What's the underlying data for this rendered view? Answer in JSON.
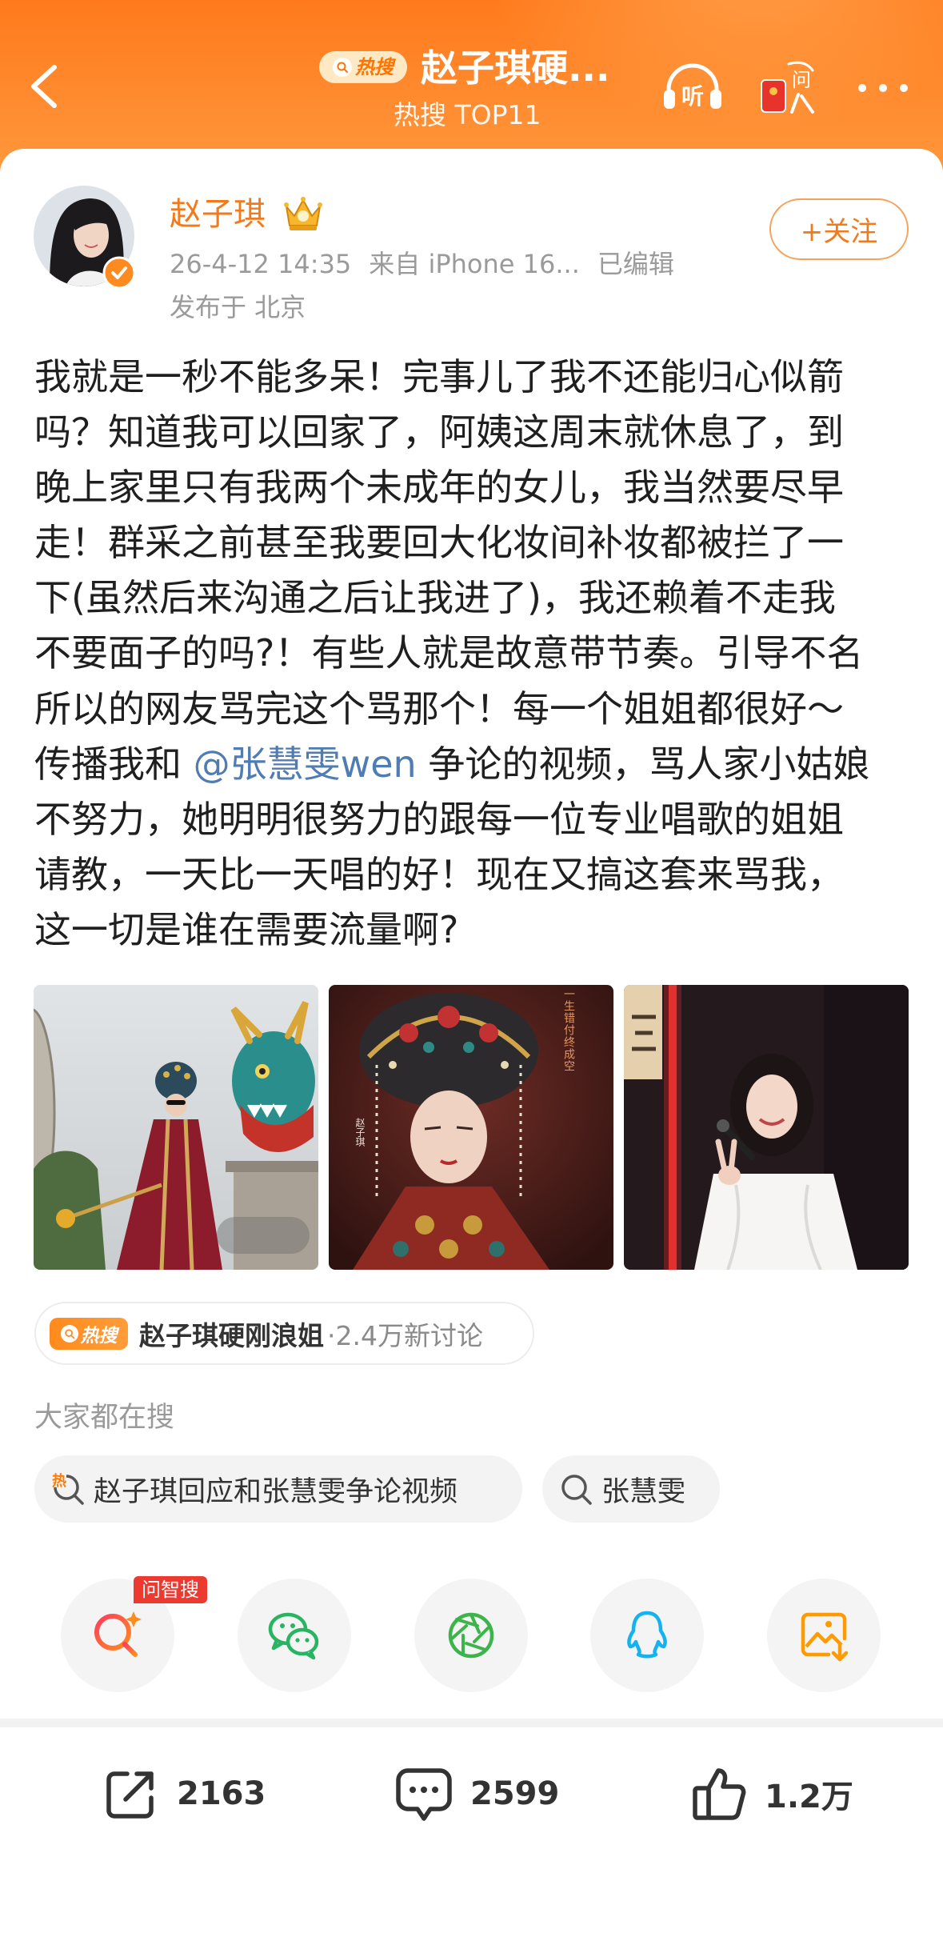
{
  "header": {
    "hot_badge": "热搜",
    "title": "赵子琪硬...",
    "subtitle": "热搜 TOP11",
    "listen_label": "听",
    "ask_label": "问",
    "icons": [
      "chevron-left-icon",
      "headphones-icon",
      "red-packet-icon",
      "more-icon"
    ]
  },
  "post": {
    "author": "赵子琪",
    "meta": {
      "time": "26-4-12 14:35",
      "source": "来自 iPhone 16...",
      "edited": "已编辑"
    },
    "location": "发布于 北京",
    "follow_label": "+关注",
    "lines": [
      [
        {
          "text": "我就是一秒不能多呆！完事儿了我不还能归心似箭"
        }
      ],
      [
        {
          "text": "吗？知道我可以回家了，阿姨这周末就休息了，到"
        }
      ],
      [
        {
          "text": "晚上家里只有我两个未成年的女儿，我当然要尽早"
        }
      ],
      [
        {
          "text": "走！群采之前甚至我要回大化妆间补妆都被拦了一"
        }
      ],
      [
        {
          "text": "下(虽然后来沟通之后让我进了)，我还赖着不走我"
        }
      ],
      [
        {
          "text": "不要面子的吗?！有些人就是故意带节奏。引导不名"
        }
      ],
      [
        {
          "text": "所以的网友骂完这个骂那个！每一个姐姐都很好～"
        }
      ],
      [
        {
          "text": "传播我和 "
        },
        {
          "text": "@张慧雯wen",
          "mention": true
        },
        {
          "text": " 争论的视频，骂人家小姑娘"
        }
      ],
      [
        {
          "text": "不努力，她明明很努力的跟每一位专业唱歌的姐姐"
        }
      ],
      [
        {
          "text": "请教，一天比一天唱的好！现在又搞这套来骂我，"
        }
      ],
      [
        {
          "text": "这一切是谁在需要流量啊?"
        }
      ]
    ],
    "gallery": {
      "tile_2_caption": "一生错付终成空",
      "tile_2_name": "赵子琪"
    }
  },
  "hot_topic": {
    "badge": "热搜",
    "title": "赵子琪硬刚浪姐",
    "stat": "·2.4万新讨论"
  },
  "search": {
    "heading": "大家都在搜",
    "chips": [
      {
        "label": "赵子琪回应和张慧雯争论视频",
        "icon": "hot-search-icon",
        "icon_char": "热"
      },
      {
        "label": "张慧雯",
        "icon": "search-icon"
      }
    ]
  },
  "share": {
    "ai_tag": "问智搜",
    "targets": [
      "ai-search-icon",
      "wechat-icon",
      "moments-icon",
      "qq-icon",
      "save-image-icon"
    ]
  },
  "actions": {
    "repost": "2163",
    "comments": "2599",
    "likes": "1.2万"
  },
  "colors": {
    "header_orange": "#ff7a1c",
    "name_orange": "#f27a1d",
    "mention_blue": "#4f7cb3",
    "ai_tag_red": "#ec3a30"
  }
}
